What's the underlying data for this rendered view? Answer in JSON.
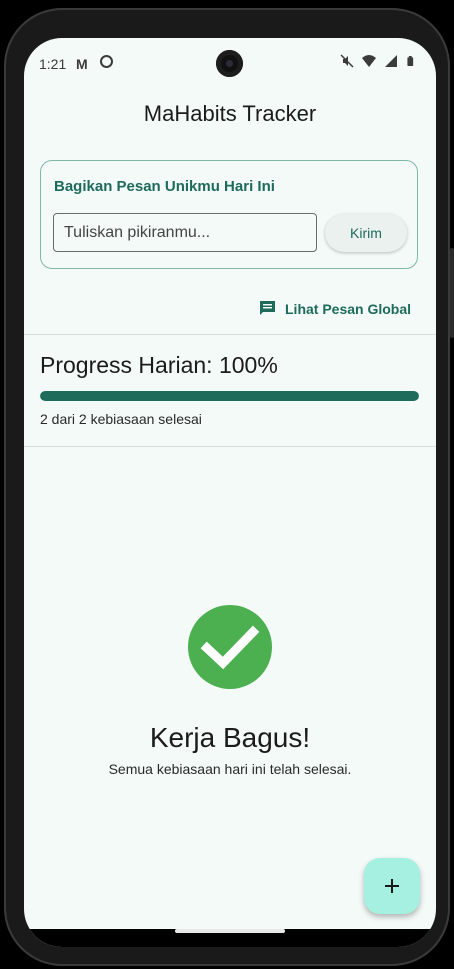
{
  "status_bar": {
    "time": "1:21",
    "left_icons": [
      "gmail-icon",
      "notification-icon"
    ],
    "right_icons": [
      "mute-icon",
      "wifi-icon",
      "signal-icon",
      "battery-icon"
    ]
  },
  "app_bar": {
    "title": "MaHabits Tracker"
  },
  "message_card": {
    "title": "Bagikan Pesan Unikmu Hari Ini",
    "input_placeholder": "Tuliskan pikiranmu...",
    "input_value": "",
    "send_label": "Kirim"
  },
  "global_link": {
    "label": "Lihat Pesan Global",
    "icon": "message-icon"
  },
  "progress": {
    "title": "Progress Harian: 100%",
    "fraction": 1.0,
    "summary": "2 dari 2 kebiasaan selesai"
  },
  "completion": {
    "icon": "check-circle-icon",
    "title": "Kerja Bagus!",
    "subtitle": "Semua kebiasaan hari ini telah selesai."
  },
  "fab": {
    "icon": "plus-icon"
  },
  "colors": {
    "primary": "#1e6b5c",
    "background": "#f3faf8",
    "success": "#4caf50",
    "fab": "#a6f0e1"
  }
}
